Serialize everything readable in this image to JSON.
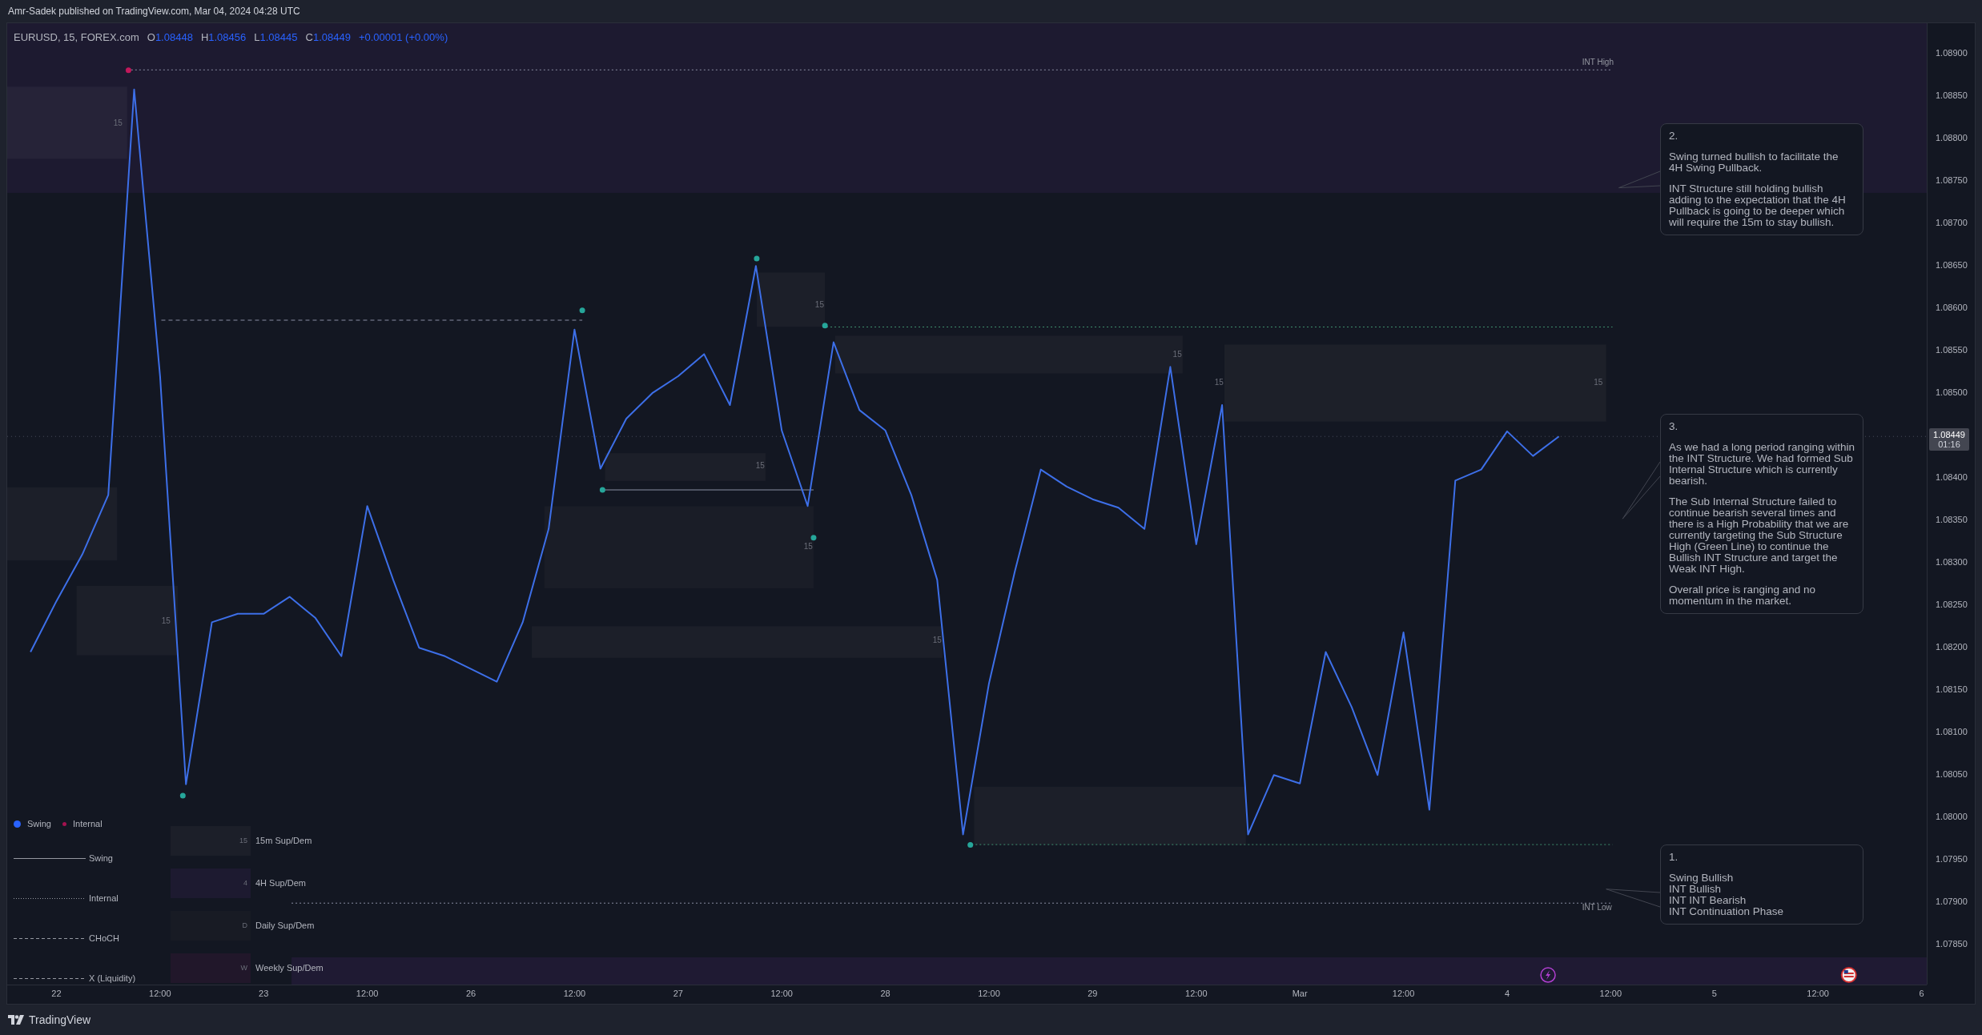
{
  "header": {
    "byline": "Amr-Sadek published on TradingView.com, Mar 04, 2024 04:28 UTC"
  },
  "symbol": {
    "name": "EURUSD, 15, FOREX.com",
    "ohlc": [
      {
        "label": "O",
        "value": "1.08448"
      },
      {
        "label": "H",
        "value": "1.08456"
      },
      {
        "label": "L",
        "value": "1.08445"
      },
      {
        "label": "C",
        "value": "1.08449"
      }
    ],
    "change": "+0.00001 (+0.00%)"
  },
  "chart": {
    "chart_data": {
      "type": "line",
      "ylim": [
        1.07803,
        1.08936
      ],
      "categories": [
        null,
        "22",
        null,
        null,
        null,
        "12:00",
        null,
        null,
        null,
        "23",
        null,
        null,
        null,
        "12:00",
        null,
        null,
        null,
        "26",
        null,
        null,
        null,
        "12:00",
        null,
        null,
        null,
        "27",
        null,
        null,
        null,
        "12:00",
        null,
        null,
        null,
        "28",
        null,
        null,
        null,
        "12:00",
        null,
        null,
        null,
        "29",
        null,
        null,
        null,
        "12:00",
        null,
        null,
        null,
        "Mar",
        null,
        null,
        null,
        "12:00",
        null,
        null,
        null,
        "4",
        null,
        null,
        null,
        "12:00",
        null,
        null,
        null,
        "5",
        null,
        null,
        null,
        "12:00",
        null,
        null,
        null,
        "6"
      ],
      "series": [
        {
          "color": "#3d6fe8",
          "values": [
            1.08195,
            1.08255,
            1.0831,
            1.0838,
            1.08858,
            1.0852,
            1.08039,
            1.0823,
            1.0824,
            1.0824,
            1.0826,
            1.08235,
            1.0819,
            1.08367,
            1.0828,
            1.082,
            1.0819,
            1.08175,
            1.0816,
            1.0823,
            1.0834,
            1.08575,
            1.08411,
            1.0847,
            1.085,
            1.0852,
            1.08546,
            1.08486,
            1.0865,
            1.08456,
            1.08367,
            1.0856,
            1.0848,
            1.08456,
            1.0838,
            1.0828,
            1.0798,
            1.08158,
            1.0829,
            1.0841,
            1.0839,
            1.08375,
            1.08365,
            1.0834,
            1.08531,
            1.08322,
            1.08486,
            1.0798,
            1.0805,
            1.0804,
            1.08195,
            1.0813,
            1.0805,
            1.08218,
            1.08009,
            1.08397,
            1.0841,
            1.08455,
            1.08426,
            1.08449,
            null,
            null,
            null,
            null,
            null,
            null,
            null,
            null,
            null,
            null,
            null,
            null,
            null,
            null
          ]
        }
      ],
      "ref_lines": [
        {
          "axis": "y",
          "value": 1.08881,
          "color": "#8a8fa3"
        },
        {
          "axis": "y",
          "value": 1.07899,
          "color": "#8a8fa3"
        },
        {
          "axis": "y",
          "value": 1.08578,
          "color": "#3f8f6e"
        },
        {
          "axis": "y",
          "value": 1.07968,
          "color": "#3f8f6e"
        },
        {
          "axis": "y",
          "value": 1.08586,
          "color": "#8a8fa3"
        },
        {
          "axis": "y",
          "value": 1.08449,
          "color": "#4a4f5e"
        },
        {
          "axis": "y",
          "value": 1.08386,
          "color": "#8a8fa3"
        }
      ],
      "yticks": [
        {
          "value": 1.089,
          "label": "1.08900"
        },
        {
          "value": 1.0885,
          "label": "1.08850"
        },
        {
          "value": 1.088,
          "label": "1.08800"
        },
        {
          "value": 1.0875,
          "label": "1.08750"
        },
        {
          "value": 1.087,
          "label": "1.08700"
        },
        {
          "value": 1.0865,
          "label": "1.08650"
        },
        {
          "value": 1.086,
          "label": "1.08600"
        },
        {
          "value": 1.0855,
          "label": "1.08550"
        },
        {
          "value": 1.085,
          "label": "1.08500"
        },
        {
          "value": 1.084,
          "label": "1.08400"
        },
        {
          "value": 1.0835,
          "label": "1.08350"
        },
        {
          "value": 1.083,
          "label": "1.08300"
        },
        {
          "value": 1.0825,
          "label": "1.08250"
        },
        {
          "value": 1.082,
          "label": "1.08200"
        },
        {
          "value": 1.0815,
          "label": "1.08150"
        },
        {
          "value": 1.081,
          "label": "1.08100"
        },
        {
          "value": 1.0805,
          "label": "1.08050"
        },
        {
          "value": 1.08,
          "label": "1.08000"
        },
        {
          "value": 1.0795,
          "label": "1.07950"
        },
        {
          "value": 1.079,
          "label": "1.07900"
        },
        {
          "value": 1.0785,
          "label": "1.07850"
        }
      ]
    },
    "price_tag": {
      "price": "1.08449",
      "countdown": "01:16"
    },
    "zone_labels": [
      "15",
      "15",
      "15",
      "15",
      "15",
      "15",
      "15",
      "15",
      "15"
    ],
    "level_labels": [
      "INT High",
      "INT Low"
    ]
  },
  "annotations": [
    {
      "title": "2.",
      "paragraphs": [
        "Swing turned bullish to facilitate the 4H Swing Pullback.",
        "INT Structure still holding bullish adding to the expectation that the 4H Pullback is going to be deeper which will require the 15m to stay bullish."
      ]
    },
    {
      "title": "3.",
      "paragraphs": [
        "As we had a long period ranging within the INT Structure. We had formed Sub Internal Structure which is currently bearish.",
        "The Sub Internal Structure failed to continue bearish several times and there is a High Probability that we are currently targeting the Sub Structure High (Green Line) to continue the Bullish INT Structure and target the Weak INT High.",
        "Overall price is ranging and no momentum in the market."
      ]
    },
    {
      "title": "1.",
      "paragraphs": [
        "Swing Bullish\nINT Bullish\nINT INT Bearish\nINT Continuation Phase"
      ]
    }
  ],
  "legend": {
    "markers": [
      {
        "label": "Swing",
        "color": "#2962ff"
      },
      {
        "label": "Internal",
        "color": "#a3124f"
      }
    ],
    "lines": [
      {
        "label": "Swing",
        "kind": "solid"
      },
      {
        "label": "Internal",
        "kind": "dotted"
      },
      {
        "label": "CHoCH",
        "kind": "dashed"
      },
      {
        "label": "X (Liquidity)",
        "kind": "dashed"
      }
    ],
    "zones": [
      {
        "label": "15m Sup/Dem",
        "tag": "15",
        "color": "#1c1f29"
      },
      {
        "label": "4H Sup/Dem",
        "tag": "4",
        "color": "#1d1a30"
      },
      {
        "label": "Daily Sup/Dem",
        "tag": "D",
        "color": "#181b24"
      },
      {
        "label": "Weekly Sup/Dem",
        "tag": "W",
        "color": "#21172a"
      }
    ]
  },
  "footer": {
    "brand": "TradingView"
  }
}
